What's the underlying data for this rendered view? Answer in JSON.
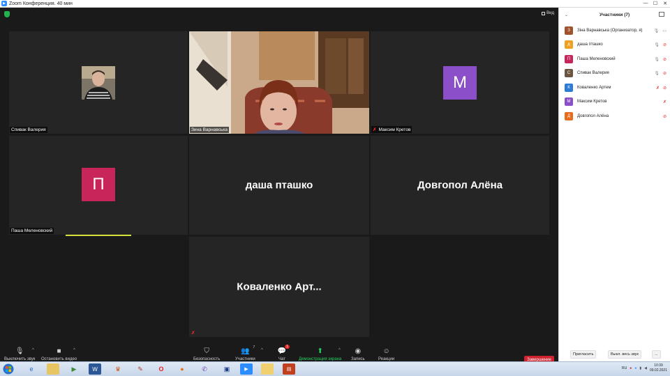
{
  "window": {
    "title": "Zoom Конференция. 40 мин",
    "controls": [
      "—",
      "☐",
      "✕"
    ]
  },
  "topbar": {
    "view_label": "Вид"
  },
  "tiles": [
    {
      "name": "Спивак Валерия",
      "type": "video"
    },
    {
      "name": "Зина Варнавська",
      "type": "video",
      "active": true
    },
    {
      "name": "Максим Кретов",
      "type": "avatar",
      "letter": "M",
      "color": "#8b4fc9",
      "muted": true
    },
    {
      "name": "Паша Меленовский",
      "type": "avatar",
      "letter": "П",
      "color": "#c8265a"
    },
    {
      "name": "даша пташко",
      "type": "name-only"
    },
    {
      "name": "Довгопол Алёна",
      "type": "name-only"
    },
    {
      "name": "Коваленко  Арт...",
      "type": "name-only",
      "muted": true
    }
  ],
  "toolbar": {
    "mute_label": "Выключить звук",
    "video_label": "Остановить видео",
    "security_label": "Безопасность",
    "participants_label": "Участники",
    "participants_count": "7",
    "chat_label": "Чат",
    "chat_badge": "1",
    "share_label": "Демонстрация экрана",
    "record_label": "Запись",
    "reactions_label": "Реакции",
    "end_label": "Завершение"
  },
  "panel": {
    "title": "Участники (7)",
    "participants": [
      {
        "name": "Зіна Варнавська (Организатор, я)",
        "initial": "З",
        "color": "#a0522d",
        "mic": "on",
        "video": "on"
      },
      {
        "name": "даша пташко",
        "initial": "д",
        "color": "#f0a020",
        "mic": "on",
        "video": "off"
      },
      {
        "name": "Паша Меленовский",
        "initial": "П",
        "color": "#c8265a",
        "mic": "on",
        "video": "off"
      },
      {
        "name": "Спивак Валерия",
        "initial": "С",
        "color": "#6b5540",
        "mic": "on",
        "video": "on"
      },
      {
        "name": "Коваленко Артем",
        "initial": "К",
        "color": "#2d7bd4",
        "mic": "off",
        "video": "off"
      },
      {
        "name": "Максим Кретов",
        "initial": "М",
        "color": "#8b4fc9",
        "mic": "off",
        "video": ""
      },
      {
        "name": "Довгопол Алёна",
        "initial": "Д",
        "color": "#e86a1a",
        "mic": "",
        "video": "off"
      }
    ],
    "invite_label": "Пригласить",
    "mute_all_label": "Выкл. весь звук",
    "more_label": "..."
  },
  "taskbar": {
    "lang": "RU",
    "time": "10:39",
    "date": "09.02.2021"
  },
  "colors": {
    "active_speaker": "#d8e33a",
    "end_red": "#d0232f",
    "share_green": "#23d160"
  }
}
